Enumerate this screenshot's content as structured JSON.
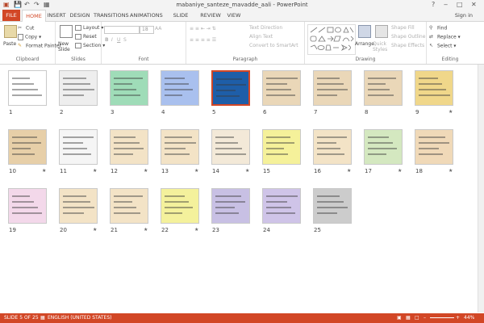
{
  "window": {
    "title": "mabaniye_santeze_mavadde_aali - PowerPoint",
    "controls": [
      "?",
      "‒",
      "□",
      "✕"
    ]
  },
  "tabs": [
    "FILE",
    "HOME",
    "INSERT",
    "DESIGN",
    "TRANSITIONS",
    "ANIMATIONS",
    "SLIDE SHOW",
    "REVIEW",
    "VIEW"
  ],
  "active_tab": "HOME",
  "signin": "Sign in",
  "ribbon": {
    "clipboard": {
      "paste": "Paste",
      "cut": "Cut",
      "copy": "Copy",
      "format_painter": "Format Painter",
      "label": "Clipboard"
    },
    "slides": {
      "new_slide": "New Slide",
      "layout": "Layout",
      "reset": "Reset",
      "section": "Section",
      "label": "Slides"
    },
    "font": {
      "size": "18",
      "label": "Font",
      "bold": "B",
      "italic": "I",
      "underline": "U",
      "strike": "S",
      "aa": "AA"
    },
    "paragraph": {
      "text_direction": "Text Direction",
      "align_text": "Align Text",
      "convert": "Convert to SmartArt",
      "label": "Paragraph"
    },
    "drawing": {
      "arrange": "Arrange",
      "quick_styles": "Quick Styles",
      "shape_fill": "Shape Fill",
      "shape_outline": "Shape Outline",
      "shape_effects": "Shape Effects",
      "label": "Drawing"
    },
    "editing": {
      "find": "Find",
      "replace": "Replace",
      "select": "Select",
      "label": "Editing"
    }
  },
  "slides": [
    {
      "n": "1",
      "star": false,
      "bg": "#ffffff"
    },
    {
      "n": "2",
      "star": false,
      "bg": "#eeeeee"
    },
    {
      "n": "3",
      "star": false,
      "bg": "#9fdcb8"
    },
    {
      "n": "4",
      "star": false,
      "bg": "#a9c0ee"
    },
    {
      "n": "5",
      "star": false,
      "bg": "#1e5ea8",
      "selected": true
    },
    {
      "n": "6",
      "star": false,
      "bg": "#ead7b8"
    },
    {
      "n": "7",
      "star": false,
      "bg": "#ead7b8"
    },
    {
      "n": "8",
      "star": false,
      "bg": "#ead7b8"
    },
    {
      "n": "9",
      "star": true,
      "bg": "#f0d78a"
    },
    {
      "n": "10",
      "star": true,
      "bg": "#e7cfa8"
    },
    {
      "n": "11",
      "star": true,
      "bg": "#f5f5f5"
    },
    {
      "n": "12",
      "star": true,
      "bg": "#f3e3c6"
    },
    {
      "n": "13",
      "star": true,
      "bg": "#f3e3c6"
    },
    {
      "n": "14",
      "star": true,
      "bg": "#f3e9d8"
    },
    {
      "n": "15",
      "star": false,
      "bg": "#f5f19a"
    },
    {
      "n": "16",
      "star": true,
      "bg": "#f3e3c6"
    },
    {
      "n": "17",
      "star": true,
      "bg": "#d4e8c0"
    },
    {
      "n": "18",
      "star": true,
      "bg": "#f0d9b8"
    },
    {
      "n": "19",
      "star": false,
      "bg": "#f3d8ea"
    },
    {
      "n": "20",
      "star": true,
      "bg": "#f3e3c6"
    },
    {
      "n": "21",
      "star": true,
      "bg": "#f3e3c6"
    },
    {
      "n": "22",
      "star": true,
      "bg": "#f4f19c"
    },
    {
      "n": "23",
      "star": false,
      "bg": "#c8c0e4"
    },
    {
      "n": "24",
      "star": false,
      "bg": "#cfc4e8"
    },
    {
      "n": "25",
      "star": false,
      "bg": "#cccccc"
    }
  ],
  "status": {
    "slide": "SLIDE 5 OF 25",
    "language": "ENGLISH (UNITED STATES)",
    "zoom": "44%"
  },
  "colors": {
    "accent": "#d24726"
  }
}
